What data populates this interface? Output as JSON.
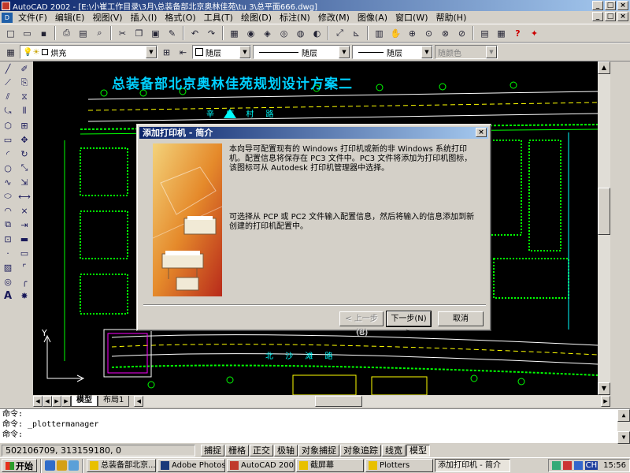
{
  "window": {
    "title": "AutoCAD 2002 - [E:\\小崔工作目录\\3月\\总装备部北京奥林佳苑\\tu 3\\总平面666.dwg]",
    "controls": [
      "_",
      "□",
      "×"
    ]
  },
  "menu": {
    "items": [
      "文件(F)",
      "编辑(E)",
      "视图(V)",
      "插入(I)",
      "格式(O)",
      "工具(T)",
      "绘图(D)",
      "标注(N)",
      "修改(M)",
      "图像(A)",
      "窗口(W)",
      "帮助(H)"
    ],
    "doc_controls": [
      "_",
      "□",
      "×"
    ]
  },
  "properties_bar": {
    "layer_value": "烘充",
    "color_value": "随层",
    "linetype_value": "随层",
    "lineweight_value": "随层",
    "plotstyle_value": "随颜色"
  },
  "drawing": {
    "title": "总装备部北京奥林佳苑规划设计方案二",
    "road_label_top": "辛 店 村 路",
    "road_label_bottom": "北 沙 滩 路",
    "ucs_y_label": "Y",
    "colors": {
      "background": "#000000",
      "green": "#00ff00",
      "cyan": "#00d0ff",
      "magenta": "#ff00ff",
      "yellow": "#ffff00"
    }
  },
  "layout_tabs": [
    "模型",
    "布局1"
  ],
  "command": {
    "lines": [
      "命令:",
      "命令:  _plottermanager",
      "命令:"
    ]
  },
  "status": {
    "coordinates": "502106709, 313159180, 0",
    "toggles": [
      {
        "label": "捕捉",
        "on": false
      },
      {
        "label": "栅格",
        "on": false
      },
      {
        "label": "正交",
        "on": false
      },
      {
        "label": "极轴",
        "on": false
      },
      {
        "label": "对象捕捉",
        "on": false
      },
      {
        "label": "对象追踪",
        "on": false
      },
      {
        "label": "线宽",
        "on": false
      },
      {
        "label": "模型",
        "on": true
      }
    ]
  },
  "taskbar": {
    "start_label": "开始",
    "items": [
      {
        "label": "总装备部北京...",
        "active": false
      },
      {
        "label": "Adobe Photoshop",
        "active": false
      },
      {
        "label": "AutoCAD 2002 ...",
        "active": false
      },
      {
        "label": "截屏幕",
        "active": false
      },
      {
        "label": "Plotters",
        "active": false
      },
      {
        "label": "添加打印机 - 简介",
        "active": true
      }
    ],
    "lang": "CH",
    "clock": "15:56"
  },
  "dialog": {
    "title": "添加打印机 - 简介",
    "close": "×",
    "paragraph1": "本向导可配置现有的 Windows 打印机或新的非 Windows 系统打印机。配置信息将保存在 PC3 文件中。PC3 文件将添加为打印机图标，该图标可从 Autodesk 打印机管理器中选择。",
    "paragraph2": "可选择从 PCP 或 PC2 文件输入配置信息，然后将输入的信息添加到新创建的打印机配置中。",
    "back_button": "< 上一步(B)",
    "next_button": "下一步(N) >",
    "cancel_button": "取消"
  }
}
